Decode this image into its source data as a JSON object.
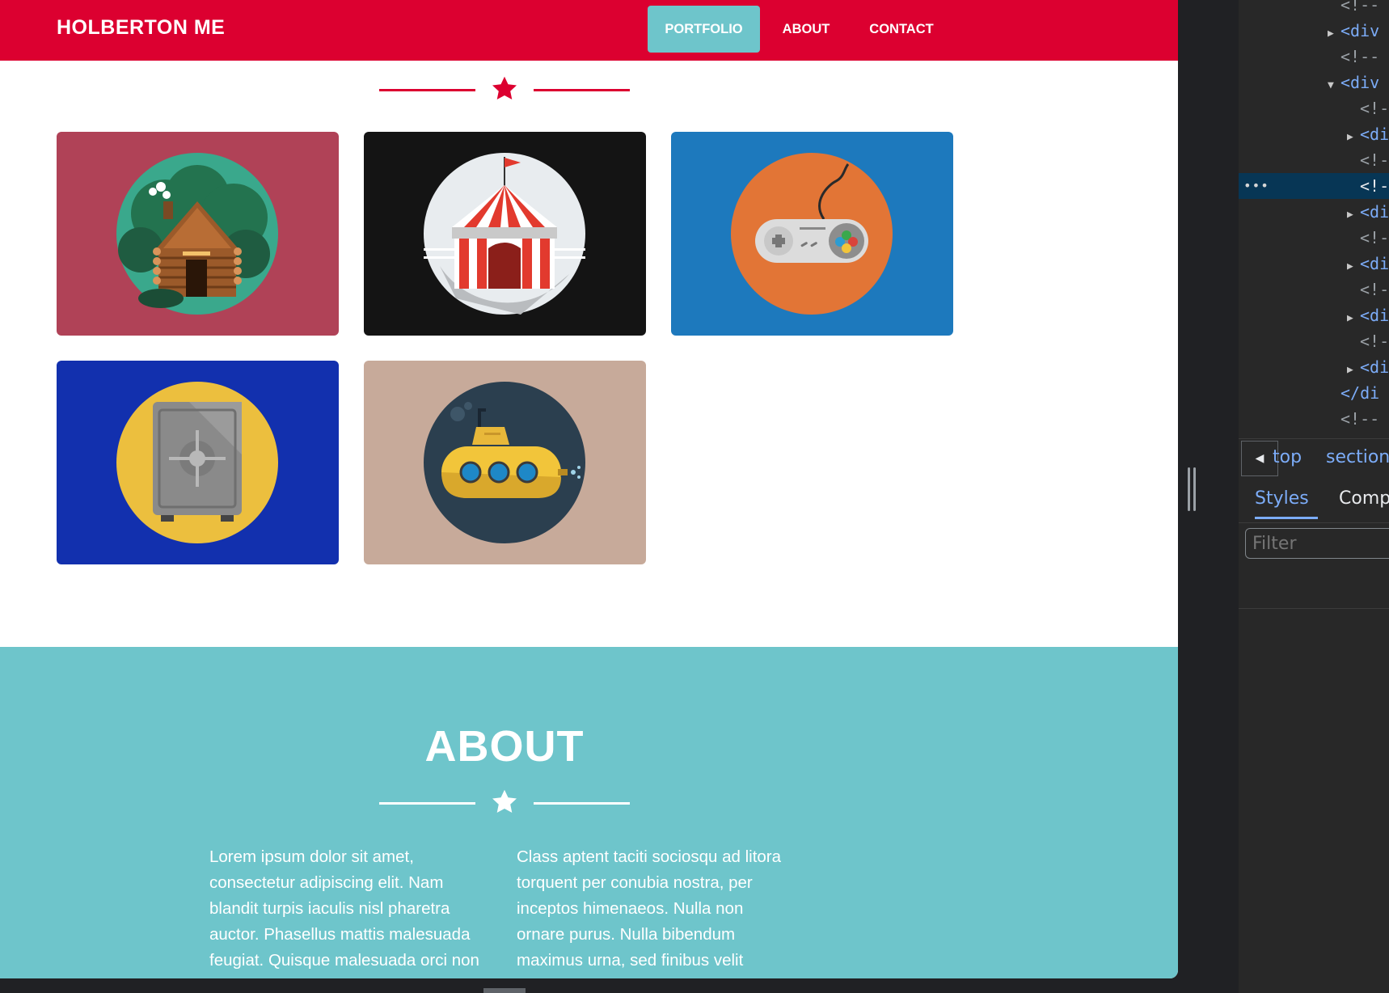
{
  "navbar": {
    "brand": "HOLBERTON ME",
    "links": [
      "PORTFOLIO",
      "ABOUT",
      "CONTACT"
    ],
    "active_link": "PORTFOLIO"
  },
  "portfolio": {
    "tiles": [
      {
        "subject": "log-cabin-icon",
        "bg_color": "#b04257"
      },
      {
        "subject": "circus-tent-icon",
        "bg_color": "#141414"
      },
      {
        "subject": "game-controller-icon",
        "bg_color": "#1d79bd"
      },
      {
        "subject": "safe-icon",
        "bg_color": "#1230ae"
      },
      {
        "subject": "submarine-icon",
        "bg_color": "#c7aa9a"
      }
    ]
  },
  "about": {
    "title": "ABOUT",
    "column_1": "Lorem ipsum dolor sit amet, consectetur adipiscing elit. Nam blandit turpis iaculis nisl pharetra auctor. Phasellus mattis malesuada feugiat. Quisque malesuada orci non",
    "column_2": "Class aptent taciti sociosqu ad litora torquent per conubia nostra, per inceptos himenaeos. Nulla non ornare purus. Nulla bibendum maximus urna, sed finibus velit tristique vel. Vivamus"
  },
  "devtools": {
    "dom_lines": [
      {
        "text": "<!--"
      },
      {
        "text": "<div"
      },
      {
        "text": "<!--"
      },
      {
        "text": "<div"
      },
      {
        "text": "<!-"
      },
      {
        "text": "<di"
      },
      {
        "text": "<!-"
      },
      {
        "text": "<!-"
      },
      {
        "text": "<di"
      },
      {
        "text": "<!-"
      },
      {
        "text": "<di"
      },
      {
        "text": "<!-"
      },
      {
        "text": "<di"
      },
      {
        "text": "<!-"
      },
      {
        "text": "<di"
      },
      {
        "text": "</di"
      },
      {
        "text": "<!--"
      }
    ],
    "selected_dots": "•••",
    "breadcrumb_top": "top",
    "breadcrumb_section": "section",
    "tab_styles": "Styles",
    "tab_computed": "Comp",
    "filter_placeholder": "Filter"
  },
  "colors": {
    "primary": "#dc0030",
    "accent": "#6ec5cb",
    "devtools_bg": "#282828",
    "devtools_tag": "#7cacf8"
  }
}
